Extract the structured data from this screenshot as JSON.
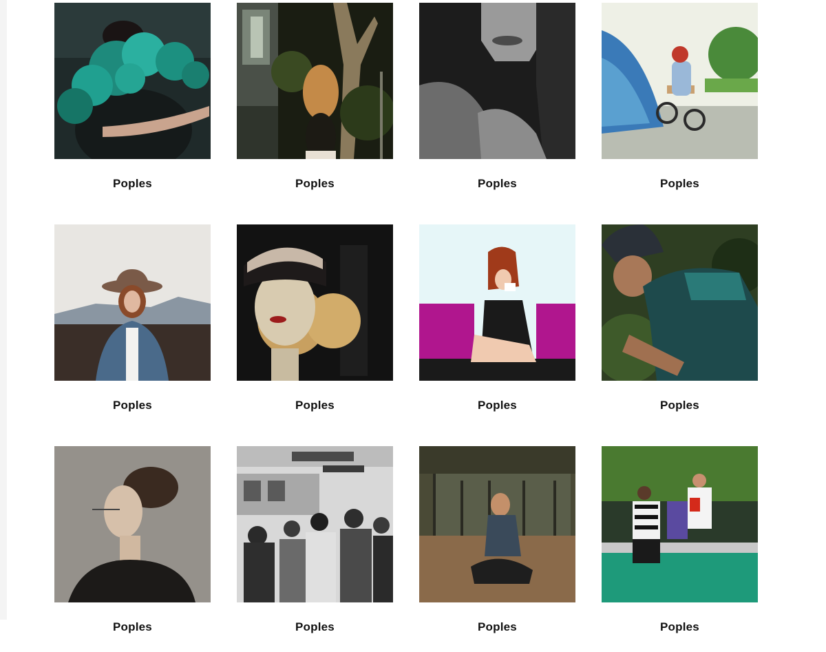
{
  "gallery": {
    "items": [
      {
        "caption": "Poples",
        "image": "person-with-teal-smoke"
      },
      {
        "caption": "Poples",
        "image": "woman-by-bus-in-forest"
      },
      {
        "caption": "Poples",
        "image": "black-and-white-portrait"
      },
      {
        "caption": "Poples",
        "image": "child-on-balance-bike"
      },
      {
        "caption": "Poples",
        "image": "woman-in-hat-denim-jacket"
      },
      {
        "caption": "Poples",
        "image": "mannequin-head-with-beanie"
      },
      {
        "caption": "Poples",
        "image": "woman-on-magenta-sofa-with-cup"
      },
      {
        "caption": "Poples",
        "image": "cyclist-with-helmet"
      },
      {
        "caption": "Poples",
        "image": "woman-with-glasses-profile"
      },
      {
        "caption": "Poples",
        "image": "crowd-at-train-station"
      },
      {
        "caption": "Poples",
        "image": "woman-sitting-on-ground"
      },
      {
        "caption": "Poples",
        "image": "lacrosse-players-and-referee"
      }
    ]
  }
}
